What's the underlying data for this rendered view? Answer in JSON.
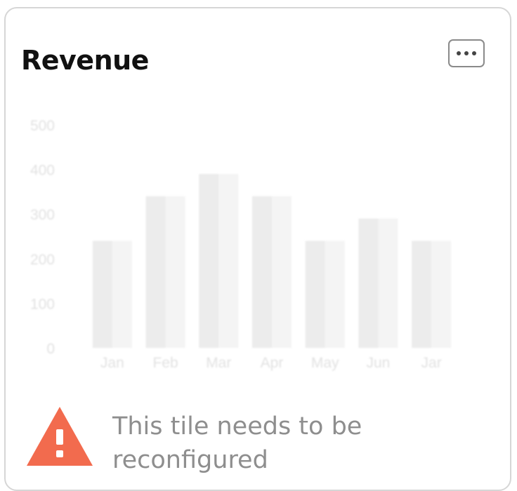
{
  "tile": {
    "title": "Revenue",
    "menu_label": "...",
    "warning_message": "This tile needs to be reconfigured"
  },
  "icons": {
    "menu": "ellipsis-icon",
    "warning": "warning-triangle-icon"
  },
  "colors": {
    "warning": "#f26b4e",
    "bar_dark": "#ececec",
    "bar_light": "#f4f4f4",
    "axis_text": "#e2e2e2"
  },
  "chart_data": {
    "type": "bar",
    "categories": [
      "Jan",
      "Feb",
      "Mar",
      "Apr",
      "May",
      "Jun",
      "Jar"
    ],
    "values": [
      240,
      340,
      390,
      340,
      240,
      290,
      240
    ],
    "ylim": [
      0,
      500
    ],
    "yticks": [
      0,
      100,
      200,
      300,
      400,
      500
    ],
    "title": "",
    "xlabel": "",
    "ylabel": "",
    "grid": false,
    "legend": "none"
  }
}
